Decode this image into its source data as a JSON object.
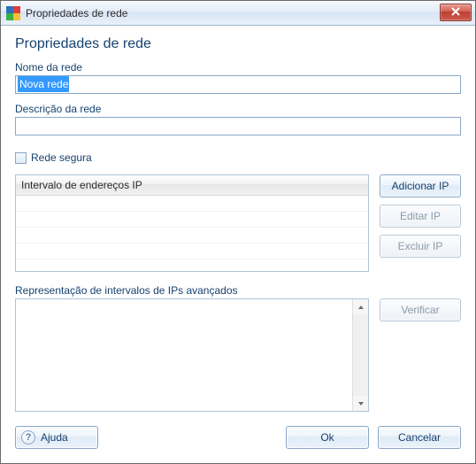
{
  "window": {
    "title": "Propriedades de rede"
  },
  "heading": "Propriedades de rede",
  "fields": {
    "name_label": "Nome da rede",
    "name_value": "Nova rede",
    "desc_label": "Descrição da rede",
    "desc_value": ""
  },
  "secure_checkbox": {
    "label": "Rede segura",
    "checked": false
  },
  "ip_table": {
    "column_header": "Intervalo de endereços IP"
  },
  "buttons": {
    "add_ip": "Adicionar IP",
    "edit_ip": "Editar IP",
    "delete_ip": "Excluir IP",
    "verify": "Verificar",
    "help": "Ajuda",
    "ok": "Ok",
    "cancel": "Cancelar"
  },
  "advanced": {
    "label": "Representação de intervalos de IPs avançados",
    "value": ""
  }
}
